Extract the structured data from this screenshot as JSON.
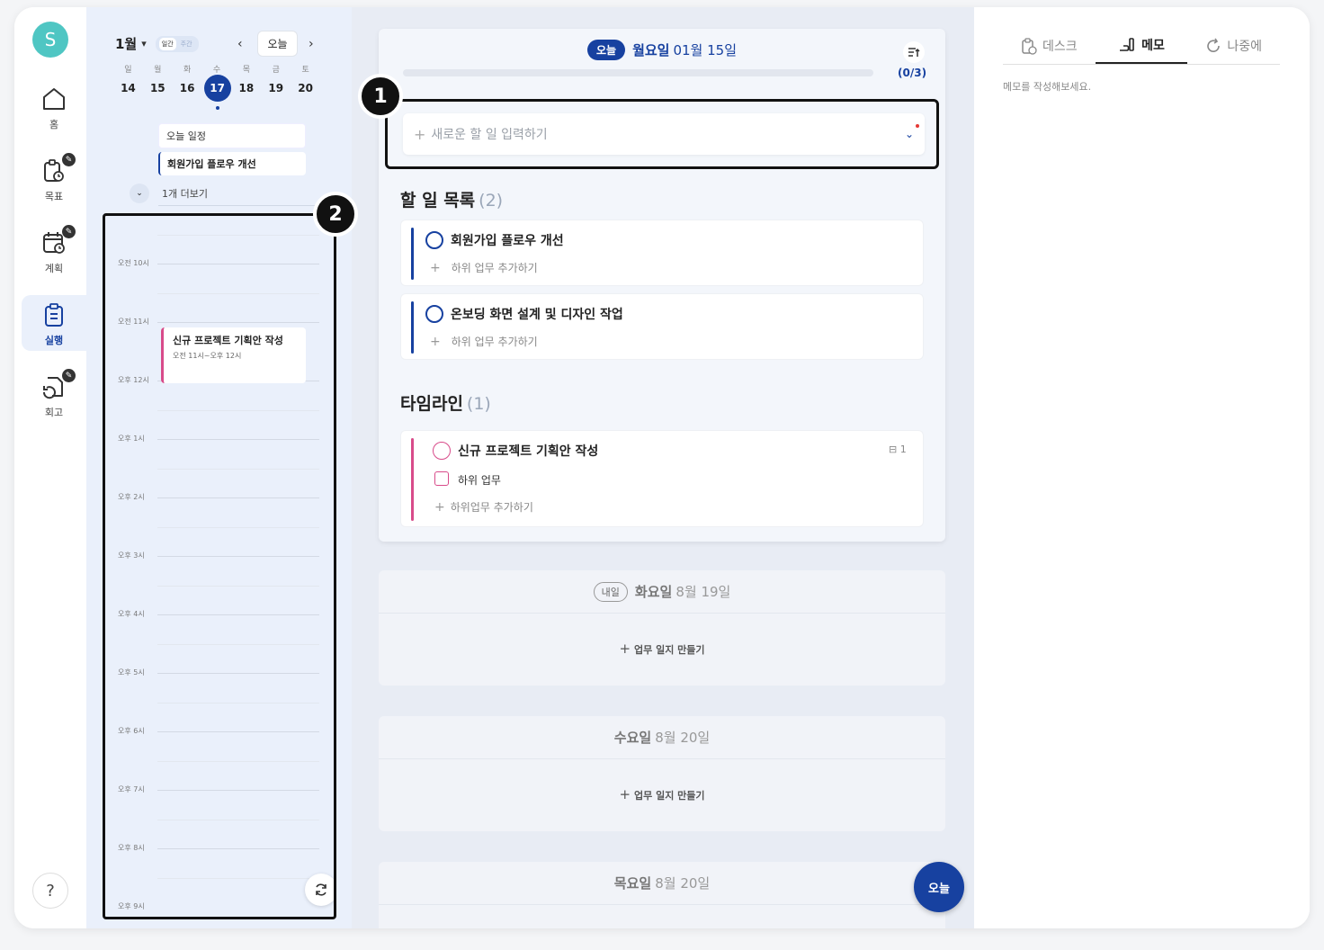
{
  "nav": {
    "avatar": "S",
    "items": [
      {
        "label": "홈",
        "icon": "home-icon"
      },
      {
        "label": "목표",
        "icon": "goal-icon"
      },
      {
        "label": "계획",
        "icon": "plan-calendar-icon"
      },
      {
        "label": "실행",
        "icon": "clipboard-icon"
      },
      {
        "label": "회고",
        "icon": "retro-icon"
      }
    ],
    "help": "?"
  },
  "calendar": {
    "month": "1월",
    "view_daily": "일간",
    "view_weekly": "주간",
    "today_button": "오늘",
    "dows": [
      "일",
      "월",
      "화",
      "수",
      "목",
      "금",
      "토"
    ],
    "dates": [
      "14",
      "15",
      "16",
      "17",
      "18",
      "19",
      "20"
    ],
    "selected_date": "17",
    "today_schedule_label": "오늘 일정",
    "today_schedule_item": "회원가입 플로우 개선",
    "more_label": "1개 더보기",
    "hours": [
      "오전 10시",
      "오전 11시",
      "오후 12시",
      "오후 1시",
      "오후 2시",
      "오후 3시",
      "오후 4시",
      "오후 5시",
      "오후 6시",
      "오후 7시",
      "오후 8시",
      "오후 9시"
    ],
    "event": {
      "title": "신규 프로젝트 기획안 작성",
      "time": "오전 11시~오후 12시"
    }
  },
  "callouts": {
    "one": "1",
    "two": "2"
  },
  "today_card": {
    "pill": "오늘",
    "day_name": "월요일",
    "date": "01월 15일",
    "progress_text": "(0/3)",
    "progress_fraction": 0,
    "new_task_placeholder": "새로운 할 일 입력하기",
    "todo_title": "할 일 목록",
    "todo_count": "(2)",
    "tasks": [
      {
        "title": "회원가입 플로우 개선",
        "sub": "하위 업무 추가하기"
      },
      {
        "title": "온보딩 화면 설계 및 디자인 작업",
        "sub": "하위 업무 추가하기"
      }
    ],
    "timeline_title": "타임라인",
    "timeline_count": "(1)",
    "timeline_item": {
      "title": "신규 프로젝트 기획안 작성",
      "sub_count": "1",
      "subtask": "하위 업무",
      "add_sub": "하위업무 추가하기"
    }
  },
  "days": [
    {
      "tag": "내일",
      "day_name": "화요일",
      "date": "8월 19일",
      "action": "업무 일지 만들기"
    },
    {
      "tag": "",
      "day_name": "수요일",
      "date": "8월 20일",
      "action": "업무 일지 만들기"
    },
    {
      "tag": "",
      "day_name": "목요일",
      "date": "8월 20일",
      "action": ""
    }
  ],
  "fab": "오늘",
  "right_panel": {
    "tabs": [
      {
        "label": "데스크",
        "icon": "desk-icon"
      },
      {
        "label": "메모",
        "icon": "memo-icon"
      },
      {
        "label": "나중에",
        "icon": "later-icon"
      }
    ],
    "memo_placeholder": "메모를 작성해보세요."
  },
  "colors": {
    "accent": "#1741a0",
    "timeline_pink": "#d84b8a",
    "calendar_bg": "#eaf0fb"
  }
}
